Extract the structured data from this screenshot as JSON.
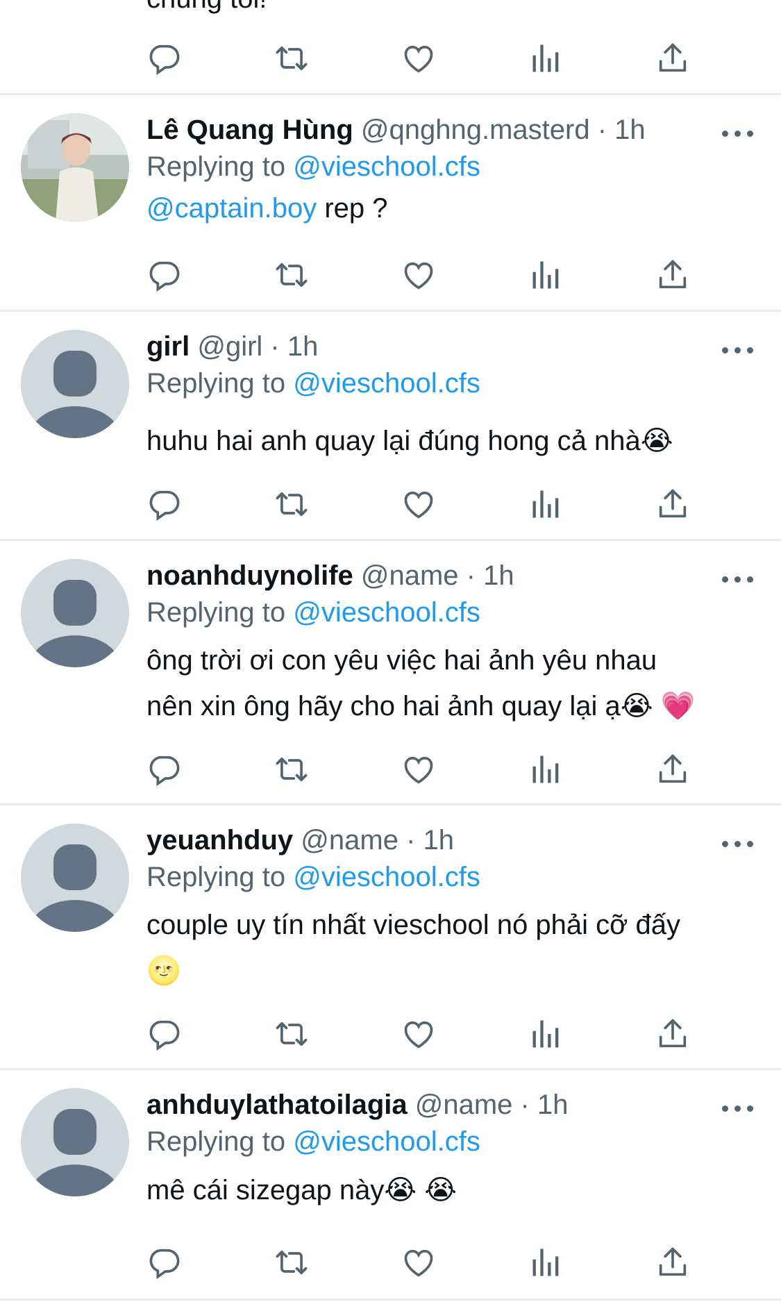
{
  "top_fragment": {
    "text": "chúng tôi!"
  },
  "tweets": [
    {
      "name": "Lê Quang Hùng",
      "handle": "@qnghng.masterd",
      "dot": " · ",
      "time": "1h",
      "reply_prefix": "Replying to ",
      "reply_to": "@vieschool.cfs",
      "mention": "@captain.boy",
      "text1": " rep ?",
      "avatar": "photo"
    },
    {
      "name": "girl",
      "handle": "@girl",
      "dot": " · ",
      "time": "1h",
      "reply_prefix": "Replying to ",
      "reply_to": "@vieschool.cfs",
      "text1": "huhu hai anh quay lại đúng hong cả nhà😭",
      "avatar": "default"
    },
    {
      "name": "noanhduynolife",
      "handle": "@name",
      "dot": " · ",
      "time": "1h",
      "reply_prefix": "Replying to ",
      "reply_to": "@vieschool.cfs",
      "text1": "ông trời ơi con yêu việc hai ảnh yêu nhau",
      "text2": "nên xin ông hãy cho hai ảnh quay lại ạ😭 💗",
      "avatar": "default"
    },
    {
      "name": "yeuanhduy",
      "handle": "@name",
      "dot": " · ",
      "time": "1h",
      "reply_prefix": "Replying to ",
      "reply_to": "@vieschool.cfs",
      "text1": "couple uy tín nhất vieschool nó phải cỡ đấy",
      "text2": "🌝",
      "avatar": "default"
    },
    {
      "name": "anhduylathatoilagia",
      "handle": "@name",
      "dot": " · ",
      "time": "1h",
      "reply_prefix": "Replying to ",
      "reply_to": "@vieschool.cfs",
      "text1": "mê cái sizegap này😭 😭",
      "avatar": "default"
    }
  ],
  "icons": [
    "reply-icon",
    "retweet-icon",
    "like-icon",
    "views-icon",
    "share-icon",
    "more-icon"
  ],
  "colors": {
    "link": "#1d9bf0",
    "secondary": "#536471",
    "divider": "#e6ecf0",
    "avatar_bg": "#cfd9de",
    "avatar_fg": "#637487"
  }
}
